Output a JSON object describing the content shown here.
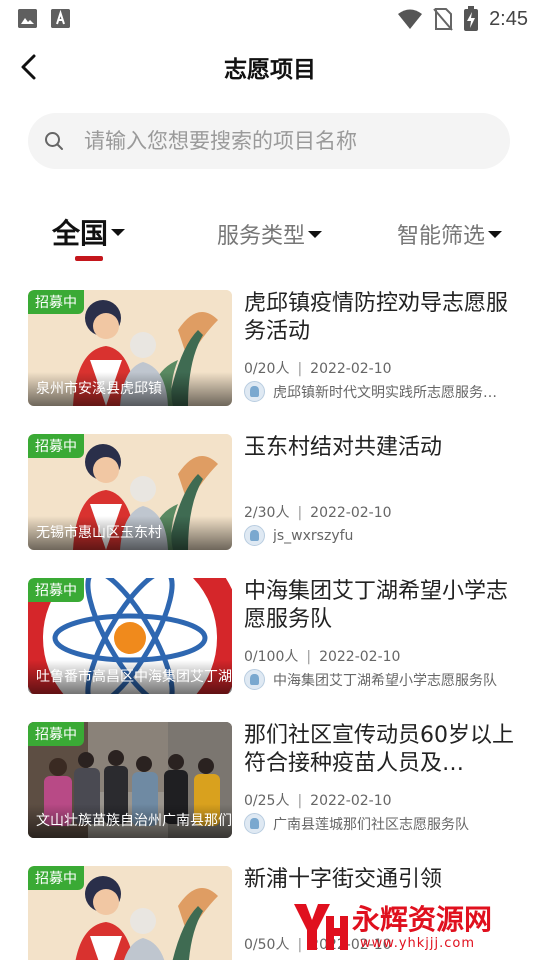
{
  "status_bar": {
    "time": "2:45"
  },
  "header": {
    "title": "志愿项目"
  },
  "search": {
    "placeholder": "请输入您想要搜索的项目名称"
  },
  "tabs": [
    {
      "label": "全国",
      "active": true
    },
    {
      "label": "服务类型",
      "active": false
    },
    {
      "label": "智能筛选",
      "active": false
    }
  ],
  "items": [
    {
      "badge": "招募中",
      "location": "泉州市安溪县虎邱镇",
      "title": "虎邱镇疫情防控劝导志愿服务活动",
      "people": "0/20人",
      "date": "2022-02-10",
      "org": "虎邱镇新时代文明实践所志愿服务…",
      "image": "volunteer-illustration"
    },
    {
      "badge": "招募中",
      "location": "无锡市惠山区玉东村",
      "title": "玉东村结对共建活动",
      "people": "2/30人",
      "date": "2022-02-10",
      "org": "js_wxrszyfu",
      "image": "volunteer-illustration"
    },
    {
      "badge": "招募中",
      "location": "吐鲁番市高昌区中海集团艾丁湖",
      "title": "中海集团艾丁湖希望小学志愿服务队",
      "people": "0/100人",
      "date": "2022-02-10",
      "org": "中海集团艾丁湖希望小学志愿服务队",
      "image": "school-emblem"
    },
    {
      "badge": "招募中",
      "location": "文山壮族苗族自治州广南县那们",
      "title": "那们社区宣传动员60岁以上符合接种疫苗人员及…",
      "people": "0/25人",
      "date": "2022-02-10",
      "org": "广南县莲城那们社区志愿服务队",
      "image": "community-photo"
    },
    {
      "badge": "招募中",
      "location": "",
      "title": "新浦十字街交通引领",
      "people": "0/50人",
      "date": "2022-02-10",
      "org": "",
      "image": "volunteer-illustration"
    }
  ],
  "watermark": {
    "brand": "永辉资源网",
    "url": "www.yhkjjj.com",
    "color": "#e0101e"
  },
  "colors": {
    "accent": "#c4161c",
    "badge": "#3aaa35"
  }
}
